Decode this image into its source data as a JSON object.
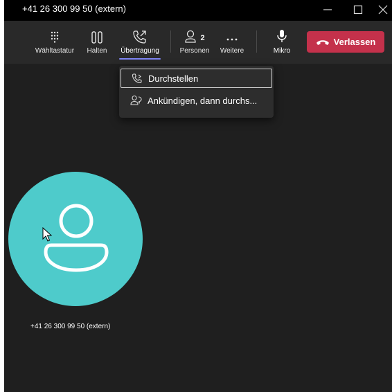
{
  "window": {
    "title": "+41 26 300 99 50 (extern)"
  },
  "toolbar": {
    "dialpad_label": "Wähltastatur",
    "hold_label": "Halten",
    "transfer_label": "Übertragung",
    "people_label": "Personen",
    "people_count": "2",
    "more_label": "Weitere",
    "mic_label": "Mikro",
    "leave_label": "Verlassen"
  },
  "transfer_menu": {
    "items": [
      {
        "label": "Durchstellen",
        "icon": "phone-forward-icon",
        "selected": true
      },
      {
        "label": "Ankündigen, dann durchs...",
        "icon": "people-consult-icon",
        "selected": false
      }
    ]
  },
  "participant": {
    "name": "+41 26 300 99 50 (extern)"
  },
  "colors": {
    "accent": "#7f85f5",
    "leave": "#c4314b",
    "avatar": "#4ecbcb"
  }
}
